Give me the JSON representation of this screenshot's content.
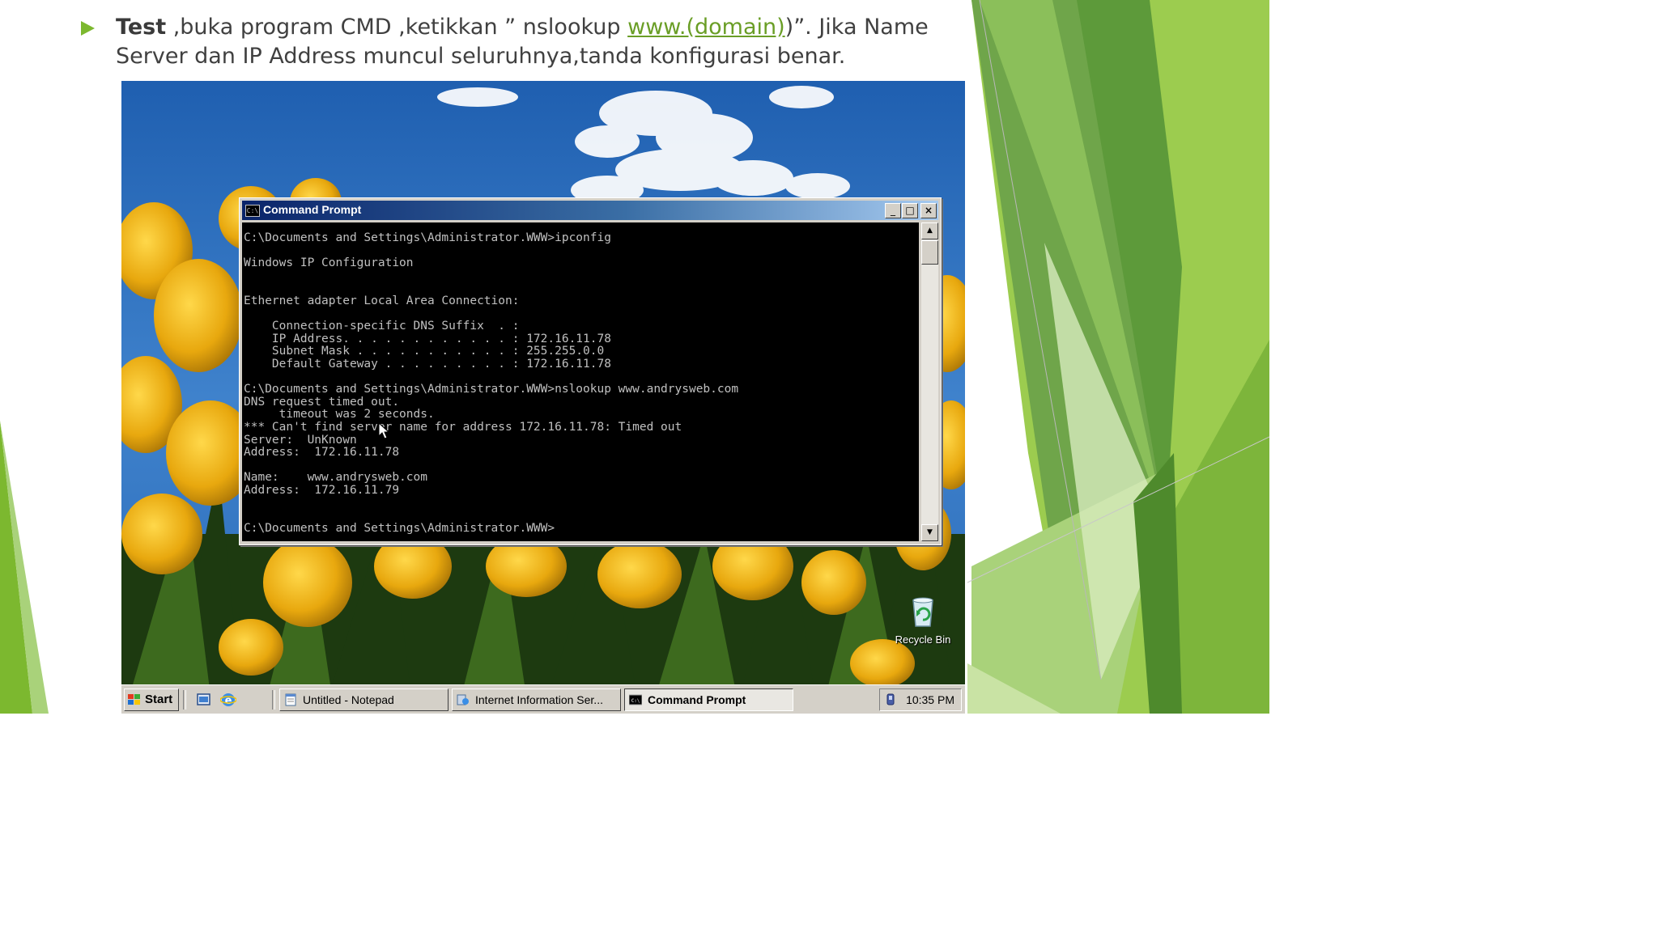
{
  "slide": {
    "bullet_strong": "Test",
    "bullet_part1": " ,buka program CMD ,ketikkan ” nslookup ",
    "bullet_link": "www.(domain)",
    "bullet_part2": ")”. Jika Name Server dan IP Address muncul seluruhnya,tanda konfigurasi benar.",
    "accent_color": "#7cb82f"
  },
  "cmd_window": {
    "title": "Command Prompt",
    "icon": "cmd-icon",
    "output": "C:\\Documents and Settings\\Administrator.WWW>ipconfig\n\nWindows IP Configuration\n\n\nEthernet adapter Local Area Connection:\n\n    Connection-specific DNS Suffix  . :\n    IP Address. . . . . . . . . . . . : 172.16.11.78\n    Subnet Mask . . . . . . . . . . . : 255.255.0.0\n    Default Gateway . . . . . . . . . : 172.16.11.78\n\nC:\\Documents and Settings\\Administrator.WWW>nslookup www.andrysweb.com\nDNS request timed out.\n     timeout was 2 seconds.\n*** Can't find server name for address 172.16.11.78: Timed out\nServer:  UnKnown\nAddress:  172.16.11.78\n\nName:    www.andrysweb.com\nAddress:  172.16.11.79\n\n\nC:\\Documents and Settings\\Administrator.WWW>"
  },
  "desktop": {
    "recycle_bin_label": "Recycle Bin"
  },
  "taskbar": {
    "start_label": "Start",
    "tasks": [
      {
        "label": "Untitled - Notepad",
        "icon": "notepad-icon"
      },
      {
        "label": "Internet Information Ser...",
        "icon": "iis-icon"
      },
      {
        "label": "Command Prompt",
        "icon": "cmd-icon"
      }
    ],
    "clock": "10:35 PM"
  }
}
